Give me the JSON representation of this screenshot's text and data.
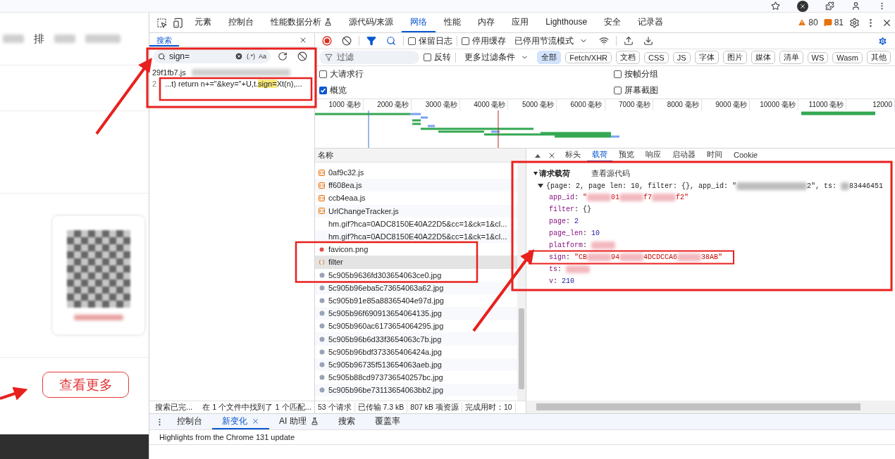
{
  "page": {
    "nav_text": "排",
    "more_button": "查看更多"
  },
  "devtools": {
    "tabs": [
      {
        "label": "元素",
        "selected": false,
        "experimental": false
      },
      {
        "label": "控制台",
        "selected": false,
        "experimental": false
      },
      {
        "label": "性能数据分析",
        "selected": false,
        "experimental": true
      },
      {
        "label": "源代码/来源",
        "selected": false,
        "experimental": false
      },
      {
        "label": "网络",
        "selected": true,
        "experimental": false
      },
      {
        "label": "性能",
        "selected": false,
        "experimental": false
      },
      {
        "label": "内存",
        "selected": false,
        "experimental": false
      },
      {
        "label": "应用",
        "selected": false,
        "experimental": false
      },
      {
        "label": "Lighthouse",
        "selected": false,
        "experimental": false
      },
      {
        "label": "安全",
        "selected": false,
        "experimental": false
      },
      {
        "label": "记录器",
        "selected": false,
        "experimental": false
      }
    ],
    "warnings": "80",
    "issues": "81"
  },
  "search_panel": {
    "tab": "搜索",
    "query": "sign=",
    "regex_toggle": "(.*)",
    "case_toggle": "Aa",
    "result_file": "29f1fb7.js",
    "result_line_no": "2",
    "result_before": "...t) return n+=\"&key=\"+U,t.",
    "result_match": "sign=",
    "result_after": "Xt(n),...",
    "status": "搜索已完...",
    "summary": "在 1 个文件中找到了 1 个匹配..."
  },
  "network": {
    "preserve_log": {
      "label": "保留日志",
      "checked": false
    },
    "disable_cache": {
      "label": "停用缓存",
      "checked": false
    },
    "throttling": "已停用节流模式",
    "filter": {
      "placeholder": "过滤",
      "invert": {
        "label": "反转",
        "checked": false
      },
      "more_filters": "更多过滤条件",
      "types": [
        {
          "label": "全部",
          "selected": true
        },
        {
          "label": "Fetch/XHR",
          "selected": false
        },
        {
          "label": "文档",
          "selected": false
        },
        {
          "label": "CSS",
          "selected": false
        },
        {
          "label": "JS",
          "selected": false
        },
        {
          "label": "字体",
          "selected": false
        },
        {
          "label": "图片",
          "selected": false
        },
        {
          "label": "媒体",
          "selected": false
        },
        {
          "label": "清单",
          "selected": false
        },
        {
          "label": "WS",
          "selected": false
        },
        {
          "label": "Wasm",
          "selected": false
        },
        {
          "label": "其他",
          "selected": false
        }
      ]
    },
    "options": [
      {
        "label": "大请求行",
        "checked": false
      },
      {
        "label": "按帧分组",
        "checked": false
      },
      {
        "label": "概览",
        "checked": true
      },
      {
        "label": "屏幕截图",
        "checked": false
      }
    ],
    "timeline_ticks": [
      "1000 毫秒",
      "2000 毫秒",
      "3000 毫秒",
      "4000 毫秒",
      "5000 毫秒",
      "6000 毫秒",
      "7000 毫秒",
      "8000 毫秒",
      "9000 毫秒",
      "10000 毫秒",
      "11000 毫秒",
      "12000"
    ],
    "column": "名称",
    "requests": [
      {
        "name": "0af9c32.js",
        "kind": "script",
        "selected": false
      },
      {
        "name": "ff608ea.js",
        "kind": "script",
        "selected": false
      },
      {
        "name": "ccb4eaa.js",
        "kind": "script",
        "selected": false
      },
      {
        "name": "UrlChangeTracker.js",
        "kind": "script",
        "selected": false
      },
      {
        "name": "hm.gif?hca=0ADC8150E40A22D5&cc=1&ck=1&cl...",
        "kind": "plain",
        "selected": false
      },
      {
        "name": "hm.gif?hca=0ADC8150E40A22D5&cc=1&ck=1&cl...",
        "kind": "plain",
        "selected": false
      },
      {
        "name": "favicon.png",
        "kind": "image",
        "selected": false
      },
      {
        "name": "filter",
        "kind": "fetch",
        "selected": true
      },
      {
        "name": "5c905b9636fd303654063ce0.jpg",
        "kind": "thumbnail",
        "selected": false
      },
      {
        "name": "5c905b96eba5c73654063a62.jpg",
        "kind": "thumbnail",
        "selected": false
      },
      {
        "name": "5c905b91e85a88365404e97d.jpg",
        "kind": "thumbnail",
        "selected": false
      },
      {
        "name": "5c905b96f690913654064135.jpg",
        "kind": "thumbnail",
        "selected": false
      },
      {
        "name": "5c905b960ac6173654064295.jpg",
        "kind": "thumbnail",
        "selected": false
      },
      {
        "name": "5c905b96b6d33f3654063c7b.jpg",
        "kind": "thumbnail",
        "selected": false
      },
      {
        "name": "5c905b96bdf373365406424a.jpg",
        "kind": "thumbnail",
        "selected": false
      },
      {
        "name": "5c905b96735f513654063aeb.jpg",
        "kind": "thumbnail",
        "selected": false
      },
      {
        "name": "5c905b88cd973736540257bc.jpg",
        "kind": "thumbnail",
        "selected": false
      },
      {
        "name": "5c905b96be73113654063bb2.jpg",
        "kind": "thumbnail",
        "selected": false
      }
    ],
    "status": [
      "53 个请求",
      "已传输 7.3 kB",
      "807 kB 项资源",
      "完成用时：10"
    ],
    "detail_tabs": [
      {
        "label": "标头",
        "selected": false
      },
      {
        "label": "载荷",
        "selected": true
      },
      {
        "label": "预览",
        "selected": false
      },
      {
        "label": "响应",
        "selected": false
      },
      {
        "label": "启动器",
        "selected": false
      },
      {
        "label": "时间",
        "selected": false
      },
      {
        "label": "Cookie",
        "selected": false
      }
    ],
    "payload": {
      "section": "请求载荷",
      "view_source": "查看源代码",
      "expanded": true,
      "summary": [
        {
          "kind": "plain",
          "text": "{page: 2, page len: 10, filter: {}, app_id: \""
        },
        {
          "kind": "redacted"
        },
        {
          "kind": "plain",
          "text": "2\", ts: "
        },
        {
          "kind": "redacted"
        },
        {
          "kind": "plain",
          "text": "83446451"
        }
      ],
      "fields": [
        [
          {
            "kind": "key",
            "text": "app_id"
          },
          {
            "kind": "plain",
            "text": ": "
          },
          {
            "kind": "string",
            "text": "\""
          },
          {
            "kind": "redacted"
          },
          {
            "kind": "string",
            "text": "01"
          },
          {
            "kind": "redacted"
          },
          {
            "kind": "string",
            "text": "f7"
          },
          {
            "kind": "redacted"
          },
          {
            "kind": "string",
            "text": "f2\""
          }
        ],
        [
          {
            "kind": "key",
            "text": "filter"
          },
          {
            "kind": "plain",
            "text": ": {}"
          }
        ],
        [
          {
            "kind": "key",
            "text": "page"
          },
          {
            "kind": "plain",
            "text": ": "
          },
          {
            "kind": "number",
            "text": "2"
          }
        ],
        [
          {
            "kind": "key",
            "text": "page_len"
          },
          {
            "kind": "plain",
            "text": ": "
          },
          {
            "kind": "number",
            "text": "10"
          }
        ],
        [
          {
            "kind": "key",
            "text": "platform"
          },
          {
            "kind": "plain",
            "text": ": "
          },
          {
            "kind": "redacted"
          }
        ],
        [
          {
            "kind": "key",
            "text": "sign"
          },
          {
            "kind": "plain",
            "text": ": "
          },
          {
            "kind": "string",
            "text": "\"CB"
          },
          {
            "kind": "redacted"
          },
          {
            "kind": "string",
            "text": "94"
          },
          {
            "kind": "redacted"
          },
          {
            "kind": "string",
            "text": "4DCDCCA6"
          },
          {
            "kind": "redacted"
          },
          {
            "kind": "string",
            "text": "38AB\""
          }
        ],
        [
          {
            "kind": "key",
            "text": "ts"
          },
          {
            "kind": "plain",
            "text": ": "
          },
          {
            "kind": "redacted"
          }
        ],
        [
          {
            "kind": "key",
            "text": "v"
          },
          {
            "kind": "plain",
            "text": ": "
          },
          {
            "kind": "number",
            "text": "210"
          }
        ]
      ]
    }
  },
  "drawer": {
    "tabs": [
      {
        "label": "控制台",
        "selected": false,
        "closable": false,
        "experimental": false
      },
      {
        "label": "新变化",
        "selected": true,
        "closable": true,
        "experimental": false
      },
      {
        "label": "AI 助理",
        "selected": false,
        "closable": false,
        "experimental": true
      },
      {
        "label": "搜索",
        "selected": false,
        "closable": false,
        "experimental": false
      },
      {
        "label": "覆盖率",
        "selected": false,
        "closable": false,
        "experimental": false
      }
    ],
    "content": "Highlights from the Chrome 131 update"
  }
}
